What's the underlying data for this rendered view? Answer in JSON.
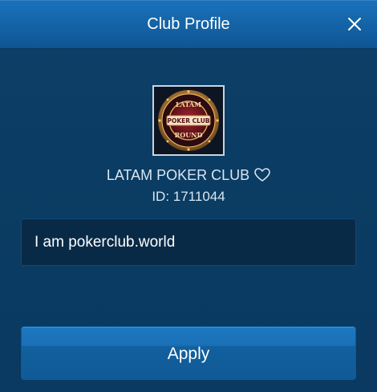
{
  "dialog": {
    "title": "Club Profile",
    "close_icon": "close-icon"
  },
  "club": {
    "name": "LATAM POKER CLUB",
    "id_label": "ID: 1711044",
    "logo": {
      "top_text": "LATAM",
      "center_text": "POKER CLUB",
      "bottom_text": "ROUND",
      "accent_color": "#c28a3a",
      "center_color": "#7a1720"
    },
    "favorite_icon": "heart-outline-icon"
  },
  "description": {
    "value": "I am pokerclub.world"
  },
  "actions": {
    "apply_label": "Apply"
  },
  "colors": {
    "header_blue": "#1565a8",
    "panel_blue": "#0b3c63",
    "button_blue": "#1a70b6"
  }
}
